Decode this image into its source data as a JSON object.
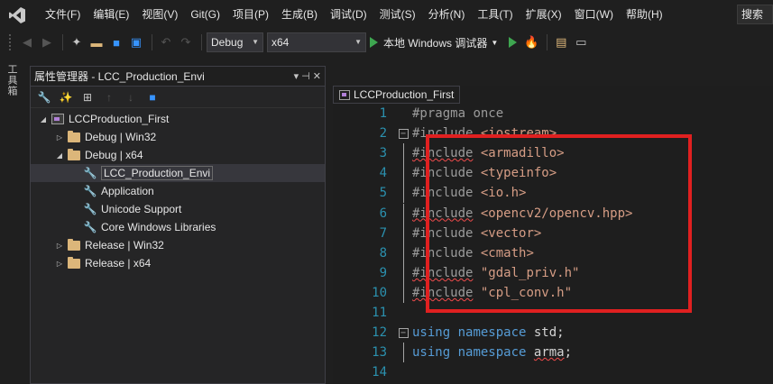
{
  "menubar": {
    "items": [
      "文件(F)",
      "编辑(E)",
      "视图(V)",
      "Git(G)",
      "项目(P)",
      "生成(B)",
      "调试(D)",
      "测试(S)",
      "分析(N)",
      "工具(T)",
      "扩展(X)",
      "窗口(W)",
      "帮助(H)"
    ],
    "search": "搜索"
  },
  "toolbar": {
    "config": "Debug",
    "platform": "x64",
    "run_label": "本地 Windows 调试器"
  },
  "side_strip": {
    "label": "工具箱"
  },
  "property_panel": {
    "title": "属性管理器 - LCC_Production_Envi",
    "pin": "▾ ⊣ ✕",
    "tree": [
      {
        "label": "LCCProduction_First",
        "kind": "project",
        "expanded": true,
        "level": 0
      },
      {
        "label": "Debug | Win32",
        "kind": "folder",
        "expanded": false,
        "level": 1
      },
      {
        "label": "Debug | x64",
        "kind": "folder",
        "expanded": true,
        "level": 1
      },
      {
        "label": "LCC_Production_Envi",
        "kind": "sheet",
        "level": 2,
        "selected": true
      },
      {
        "label": "Application",
        "kind": "sheet",
        "level": 2
      },
      {
        "label": "Unicode Support",
        "kind": "sheet",
        "level": 2
      },
      {
        "label": "Core Windows Libraries",
        "kind": "sheet",
        "level": 2
      },
      {
        "label": "Release | Win32",
        "kind": "folder",
        "expanded": false,
        "level": 1
      },
      {
        "label": "Release | x64",
        "kind": "folder",
        "expanded": false,
        "level": 1
      }
    ]
  },
  "editor": {
    "tab": "LCCProduction_First",
    "lines": [
      {
        "n": "1",
        "t": "#pragma once"
      },
      {
        "n": "2",
        "t": "#include <iostream>"
      },
      {
        "n": "3",
        "t": "#include <armadillo>"
      },
      {
        "n": "4",
        "t": "#include <typeinfo>"
      },
      {
        "n": "5",
        "t": "#include <io.h>"
      },
      {
        "n": "6",
        "t": "#include <opencv2/opencv.hpp>"
      },
      {
        "n": "7",
        "t": "#include <vector>"
      },
      {
        "n": "8",
        "t": "#include <cmath>"
      },
      {
        "n": "9",
        "t": "#include \"gdal_priv.h\""
      },
      {
        "n": "10",
        "t": "#include \"cpl_conv.h\""
      },
      {
        "n": "11",
        "t": ""
      },
      {
        "n": "12",
        "t": "using namespace std;"
      },
      {
        "n": "13",
        "t": "using namespace arma;"
      },
      {
        "n": "14",
        "t": ""
      }
    ]
  },
  "colors": {
    "accent_highlight": "#e02020",
    "keyword": "#569cd6",
    "string": "#d69d85",
    "line_number": "#2b91af"
  }
}
